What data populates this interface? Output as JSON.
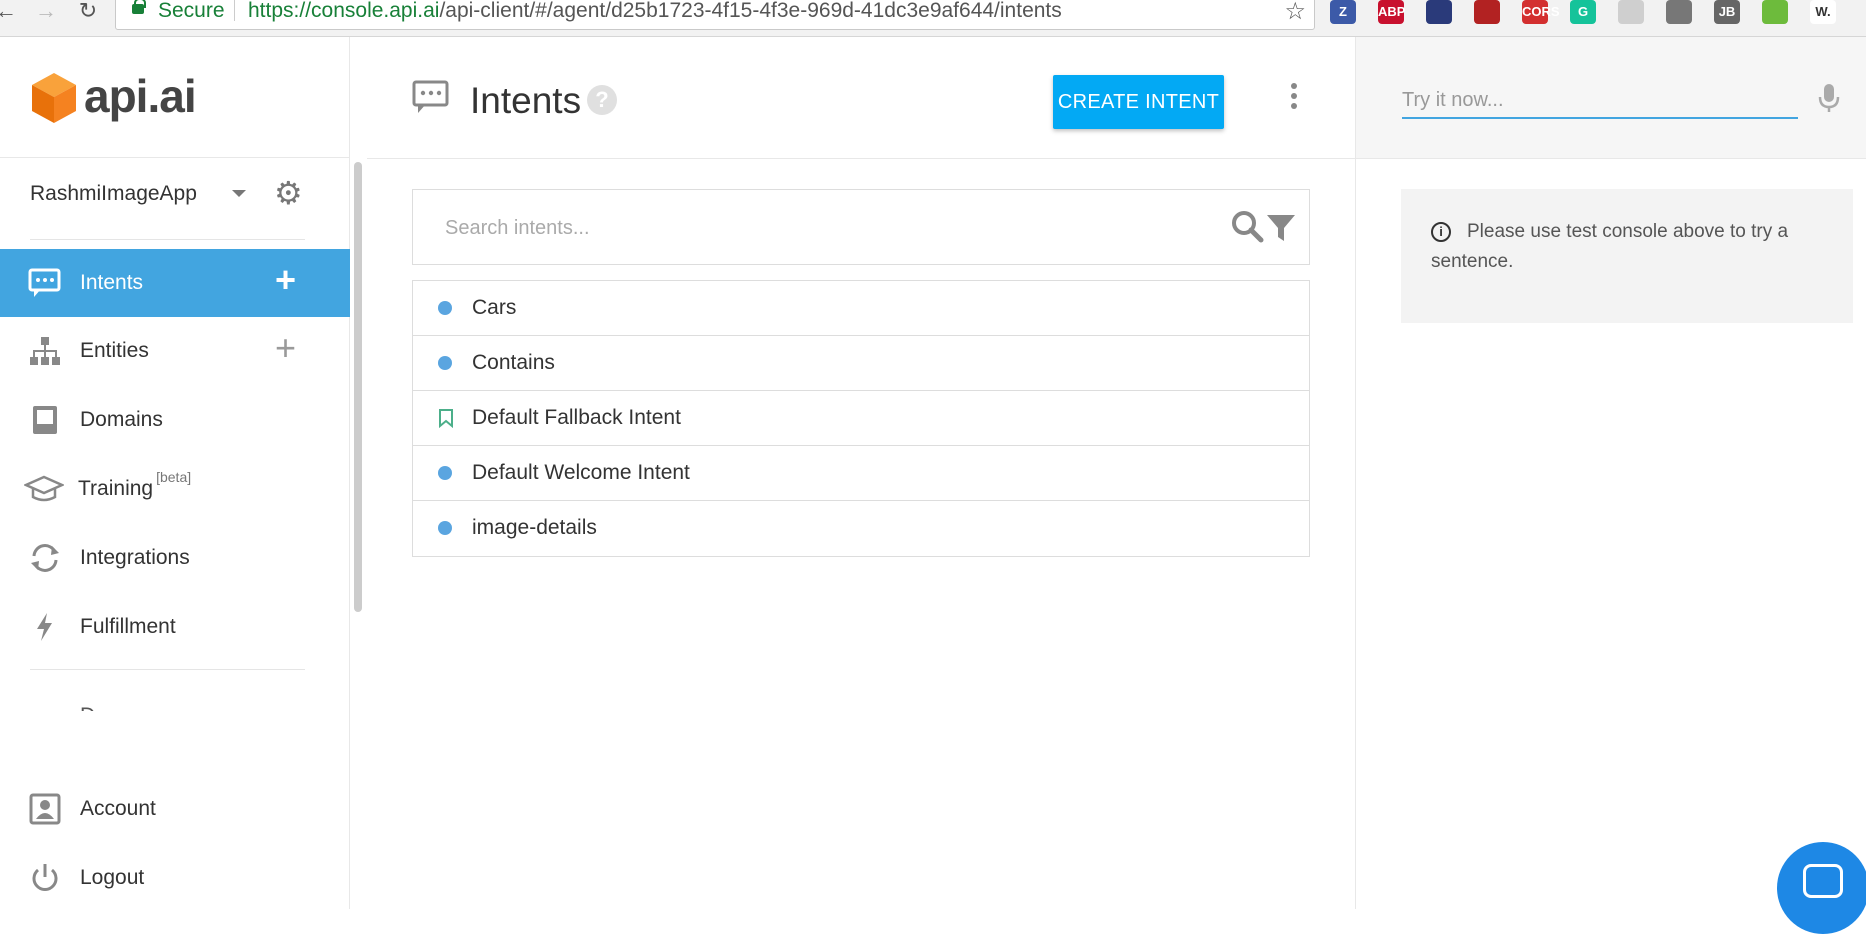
{
  "browser": {
    "secure_label": "Secure",
    "url_host": "https://console.api.ai",
    "url_path": "/api-client/#/agent/d25b1723-4f15-4f3e-969d-41dc3e9af644/intents",
    "extensions": [
      {
        "name": "zotero-extension-icon",
        "label": "Z",
        "color": "#3c5aa8"
      },
      {
        "name": "adblock-extension-icon",
        "label": "ABP",
        "color": "#c8102e"
      },
      {
        "name": "night-extension-icon",
        "label": "",
        "color": "#2a3a7a"
      },
      {
        "name": "book-extension-icon",
        "label": "",
        "color": "#b22222"
      },
      {
        "name": "cors-extension-icon",
        "label": "CORS",
        "color": "#d32f2f"
      },
      {
        "name": "grammarly-extension-icon",
        "label": "G",
        "color": "#15c39a"
      },
      {
        "name": "extension-icon",
        "label": "",
        "color": "#cfcfcf"
      },
      {
        "name": "bulb-extension-icon",
        "label": "",
        "color": "#777777"
      },
      {
        "name": "jb-extension-icon",
        "label": "JB",
        "color": "#666666"
      },
      {
        "name": "frog-extension-icon",
        "label": "",
        "color": "#6dbb3c"
      },
      {
        "name": "w-extension-icon",
        "label": "W.",
        "color": "#ffffff"
      }
    ]
  },
  "logo": {
    "text": "api.ai",
    "accent": "#f57c00"
  },
  "agent": {
    "name": "RashmiImageApp"
  },
  "menu": {
    "items": [
      {
        "label": "Intents",
        "active": true
      },
      {
        "label": "Entities"
      },
      {
        "label": "Domains"
      },
      {
        "label": "Training",
        "badge": "[beta]"
      },
      {
        "label": "Integrations"
      },
      {
        "label": "Fulfillment"
      }
    ],
    "account_label": "Account",
    "logout_label": "Logout",
    "active_color": "#42a5e0"
  },
  "main": {
    "title": "Intents",
    "help_glyph": "?",
    "create_button": "CREATE INTENT",
    "search_placeholder": "Search intents...",
    "intents": [
      {
        "name": "Cars",
        "kind": "dot"
      },
      {
        "name": "Contains",
        "kind": "dot"
      },
      {
        "name": "Default Fallback Intent",
        "kind": "bookmark"
      },
      {
        "name": "Default Welcome Intent",
        "kind": "dot"
      },
      {
        "name": "image-details",
        "kind": "dot"
      }
    ],
    "button_color": "#03a9f4"
  },
  "right": {
    "try_placeholder": "Try it now...",
    "info_text": "Please use test console above to try a sentence."
  }
}
